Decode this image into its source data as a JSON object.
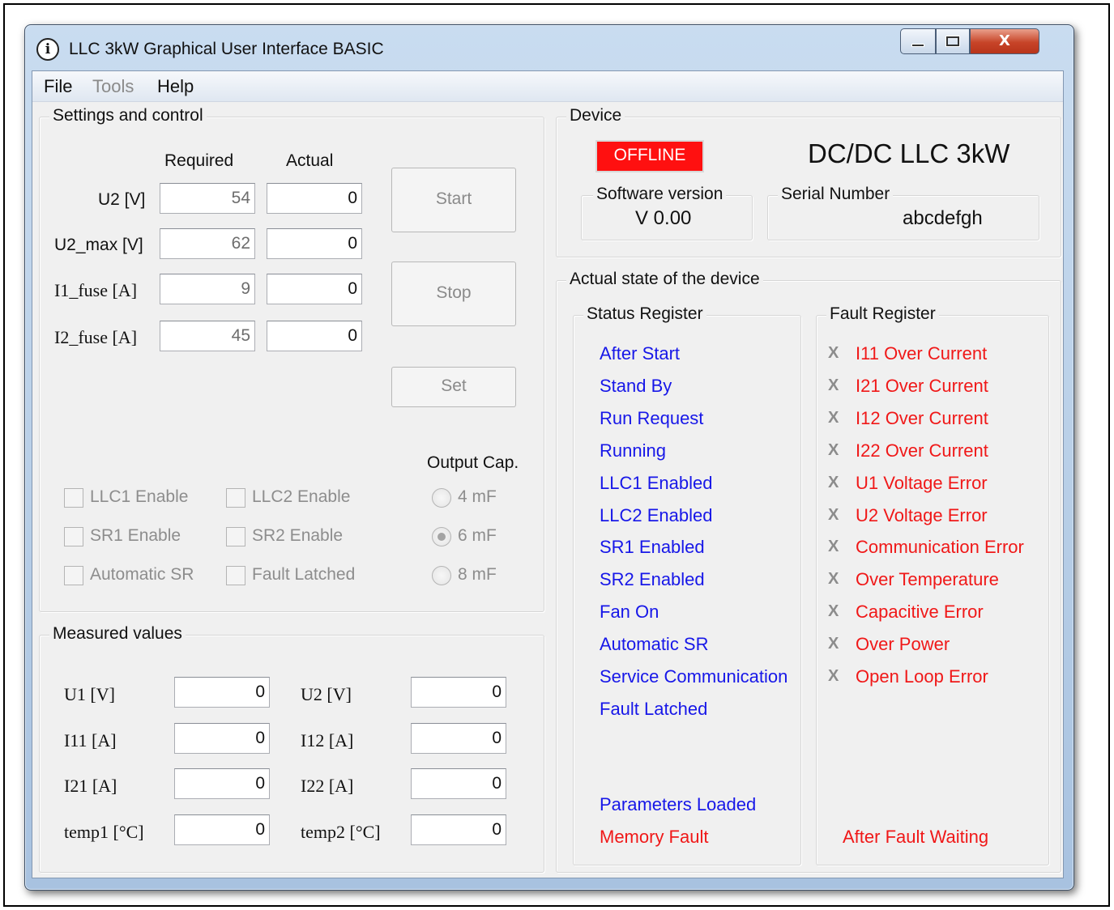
{
  "window": {
    "title": "LLC 3kW Graphical User Interface BASIC",
    "icon": "app-logo-icon",
    "controls": {
      "minimize": "minimize-icon",
      "maximize": "maximize-icon",
      "close_label": "X"
    }
  },
  "menu": {
    "file": "File",
    "tools": "Tools",
    "help": "Help"
  },
  "settings": {
    "title": "Settings and control",
    "col_required": "Required",
    "col_actual": "Actual",
    "rows": [
      {
        "label": "U2 [V]",
        "required": "54",
        "actual": "0"
      },
      {
        "label": "U2_max [V]",
        "required": "62",
        "actual": "0"
      },
      {
        "label": "I1_fuse [A]",
        "required": "9",
        "actual": "0"
      },
      {
        "label": "I2_fuse [A]",
        "required": "45",
        "actual": "0"
      }
    ],
    "start": "Start",
    "stop": "Stop",
    "set": "Set",
    "output_cap": "Output Cap.",
    "checkboxes": [
      "LLC1 Enable",
      "LLC2 Enable",
      "SR1 Enable",
      "SR2 Enable",
      "Automatic SR",
      "Fault Latched"
    ],
    "cap_options": [
      "4 mF",
      "6 mF",
      "8 mF"
    ],
    "cap_selected": "6 mF"
  },
  "measured": {
    "title": "Measured values",
    "left": [
      {
        "label": "U1 [V]",
        "value": "0"
      },
      {
        "label": "I11 [A]",
        "value": "0"
      },
      {
        "label": "I21 [A]",
        "value": "0"
      },
      {
        "label": "temp1 [°C]",
        "value": "0"
      }
    ],
    "right": [
      {
        "label": "U2 [V]",
        "value": "0"
      },
      {
        "label": "I12 [A]",
        "value": "0"
      },
      {
        "label": "I22 [A]",
        "value": "0"
      },
      {
        "label": "temp2 [°C]",
        "value": "0"
      }
    ]
  },
  "device": {
    "title": "Device",
    "status": "OFFLINE",
    "name": "DC/DC LLC 3kW",
    "sw_label": "Software version",
    "sw_value": "V 0.00",
    "sn_label": "Serial Number",
    "sn_value": "abcdefgh"
  },
  "state": {
    "title": "Actual state of the device",
    "status_title": "Status Register",
    "status_items": [
      "After Start",
      "Stand By",
      "Run Request",
      "Running",
      "LLC1 Enabled",
      "LLC2 Enabled",
      "SR1 Enabled",
      "SR2 Enabled",
      "Fan On",
      "Automatic SR",
      "Service Communication",
      "Fault Latched"
    ],
    "params_loaded": "Parameters Loaded",
    "memory_fault": "Memory Fault",
    "fault_title": "Fault Register",
    "fault_marker": "X",
    "fault_items": [
      "I11 Over Current",
      "I21 Over Current",
      "I12 Over Current",
      "I22 Over Current",
      "U1 Voltage Error",
      "U2 Voltage Error",
      "Communication Error",
      "Over Temperature",
      "Capacitive Error",
      "Over Power",
      "Open Loop Error"
    ],
    "after_fault": "After Fault Waiting"
  },
  "colors": {
    "status_blue": "#1717e8",
    "fault_red": "#f01818",
    "offline_bg": "#ff1010"
  }
}
